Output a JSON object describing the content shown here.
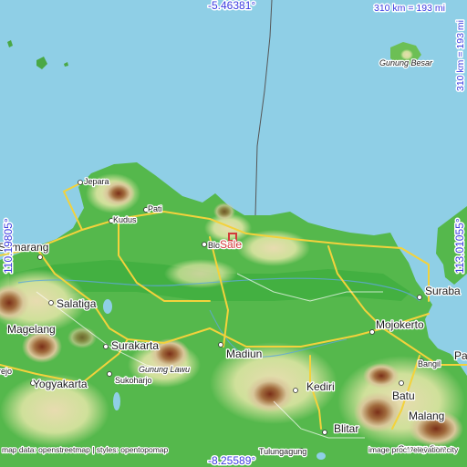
{
  "map": {
    "place": "Sale",
    "colors": {
      "sea": "#8fcfe6",
      "lowland": "#4fb548",
      "upland": "#c9b878",
      "peak": "#8a3a20",
      "road": "#f3d23c",
      "marker": "#d23a3a",
      "coord_text": "#3b3be0"
    },
    "coordinates": {
      "top": "-5.46381°",
      "bottom": "-8.25589°",
      "left": "110.19805°",
      "right": "113.01055°"
    },
    "scale": {
      "horizontal": "310 km = 193 mi",
      "vertical": "310 km = 193 mi"
    },
    "cities": {
      "semarang": "Semarang",
      "salatiga": "Salatiga",
      "magelang": "Magelang",
      "yogyakarta": "Yogyakarta",
      "surakarta": "Surakarta",
      "sukoharjo": "Sukoharjo",
      "madiun": "Madiun",
      "kediri": "Kediri",
      "blitar": "Blitar",
      "tulungagung": "Tulungagung",
      "malang": "Malang",
      "batu": "Batu",
      "bangil": "Bangil",
      "mojokerto": "Mojokerto",
      "surabaya": "Suraba",
      "pasuruan": "Pa",
      "jepara": "Jepara",
      "kudus": "Kudus",
      "pati": "Pati",
      "blora": "Blo",
      "rejo": "rejo"
    },
    "mountains": {
      "lawu": "Gunung Lawu",
      "besar": "Gunung Besar",
      "semeru": "Gunung Sem"
    },
    "credits": {
      "map_data": "map data: openstreetmap | styles: opentopomap",
      "image_proc": "image proc.: elevation.city"
    }
  }
}
